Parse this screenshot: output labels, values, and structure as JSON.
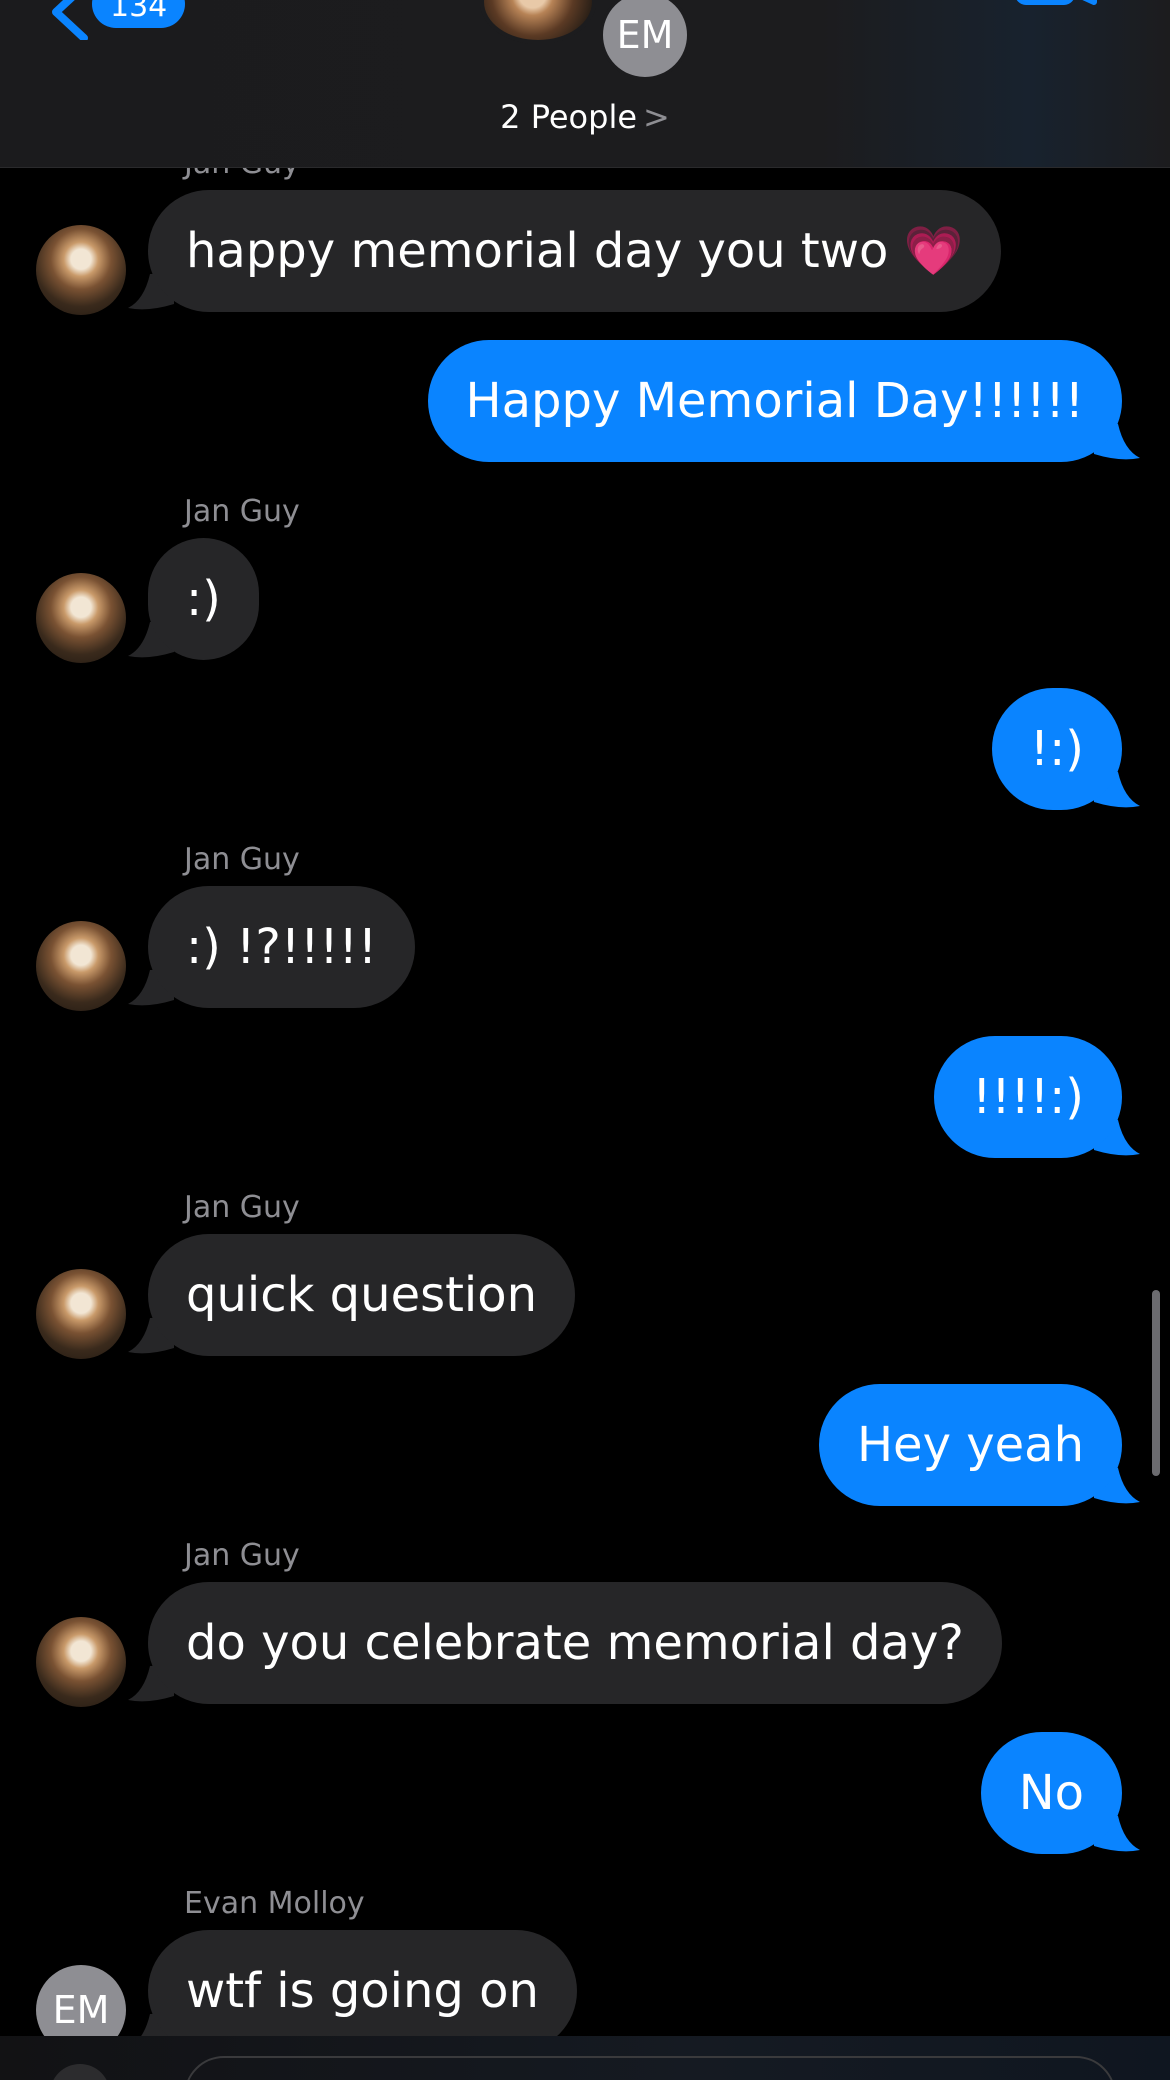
{
  "header": {
    "back_badge": "134",
    "group_member_initials": "EM",
    "people_label": "2 People",
    "people_chevron": ">"
  },
  "messages": [
    {
      "direction": "in",
      "sender": "Jan Guy",
      "text": "happy memorial day you two 💗"
    },
    {
      "direction": "out",
      "text": "Happy Memorial Day!!!!!!"
    },
    {
      "direction": "in",
      "sender": "Jan Guy",
      "text": ":)"
    },
    {
      "direction": "out",
      "text": "!:)"
    },
    {
      "direction": "in",
      "sender": "Jan Guy",
      "text": ":) !?!!!!!"
    },
    {
      "direction": "out",
      "text": "!!!!:)"
    },
    {
      "direction": "in",
      "sender": "Jan Guy",
      "text": "quick question"
    },
    {
      "direction": "out",
      "text": "Hey yeah"
    },
    {
      "direction": "in",
      "sender": "Jan Guy",
      "text": "do you celebrate memorial day?"
    },
    {
      "direction": "out",
      "text": "No"
    },
    {
      "direction": "in",
      "sender": "Evan Molloy",
      "sender_initials": "EM",
      "text": "wtf is going on"
    }
  ],
  "colors": {
    "outgoing_bubble": "#0a84ff",
    "incoming_bubble": "#262628",
    "background": "#000000",
    "sender_label": "#8e8e93"
  }
}
